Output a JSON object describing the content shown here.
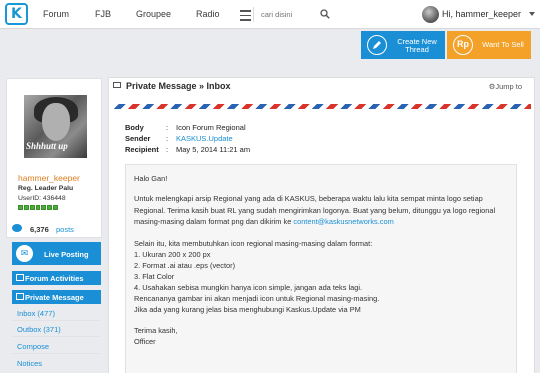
{
  "header": {
    "logo_text": "K",
    "nav": [
      "Forum",
      "FJB",
      "Groupee",
      "Radio"
    ],
    "search_placeholder": "cari disini",
    "greeting": "Hi, hammer_keeper"
  },
  "actions": {
    "create_thread": "Create New Thread",
    "create_thread_line1": "Create New",
    "create_thread_line2": "Thread",
    "sell_icon": "Rp",
    "want_to_sell": "Want To Sell"
  },
  "profile": {
    "photo_caption": "Shhhutt up",
    "username": "hammer_keeper",
    "rank": "Reg. Leader Palu",
    "user_id": "UserID: 436448",
    "post_count": "6,376",
    "posts_label": "posts"
  },
  "sidebar": {
    "live_posting": "Live Posting",
    "forum_activities": "Forum Activities",
    "private_message": "Private Message",
    "links": [
      "Inbox (477)",
      "Outbox (371)",
      "Compose",
      "Notices"
    ]
  },
  "main": {
    "title": "Private Message » Inbox",
    "jump_to": "Jump to",
    "meta": {
      "body_label": "Body",
      "body_value": "Icon Forum Regional",
      "sender_label": "Sender",
      "sender_value": "KASKUS.Update",
      "recipient_label": "Recipient",
      "recipient_value": "May 5, 2014 11:21 am"
    },
    "message": {
      "greeting": "Halo Gan!",
      "p1_l1": "Untuk melengkapi arsip Regional yang ada di KASKUS, beberapa waktu lalu kita sempat minta logo setiap",
      "p1_l2": "Regional. Terima kasih buat RL yang sudah mengirimkan logonya. Buat yang belum, ditunggu ya logo regional",
      "p1_l3_pre": "masing-masing dalam format png dan dikirim ke ",
      "p1_l3_link": "content@kaskusnetworks.com",
      "p2_intro": "Selain itu, kita membutuhkan icon regional masing-masing dalam format:",
      "list": [
        "1. Ukuran 200 x 200 px",
        "2. Format .ai atau .eps (vector)",
        "3. Flat Color",
        "4. Usahakan sebisa mungkin hanya icon simple, jangan ada teks lagi."
      ],
      "p3_l1": "Rencananya gambar ini akan menjadi icon untuk Regional masing-masing.",
      "p3_l2": "Jika ada yang kurang jelas bisa menghubungi Kaskus.Update via PM",
      "closing": "Terima kasih,",
      "signature": "Officer"
    }
  },
  "colors": {
    "brand_blue": "#1a8fd6",
    "orange": "#f4a12a",
    "username_orange": "#e07d1f",
    "airmail_red": "#d9332b",
    "airmail_blue": "#2a63b3"
  }
}
